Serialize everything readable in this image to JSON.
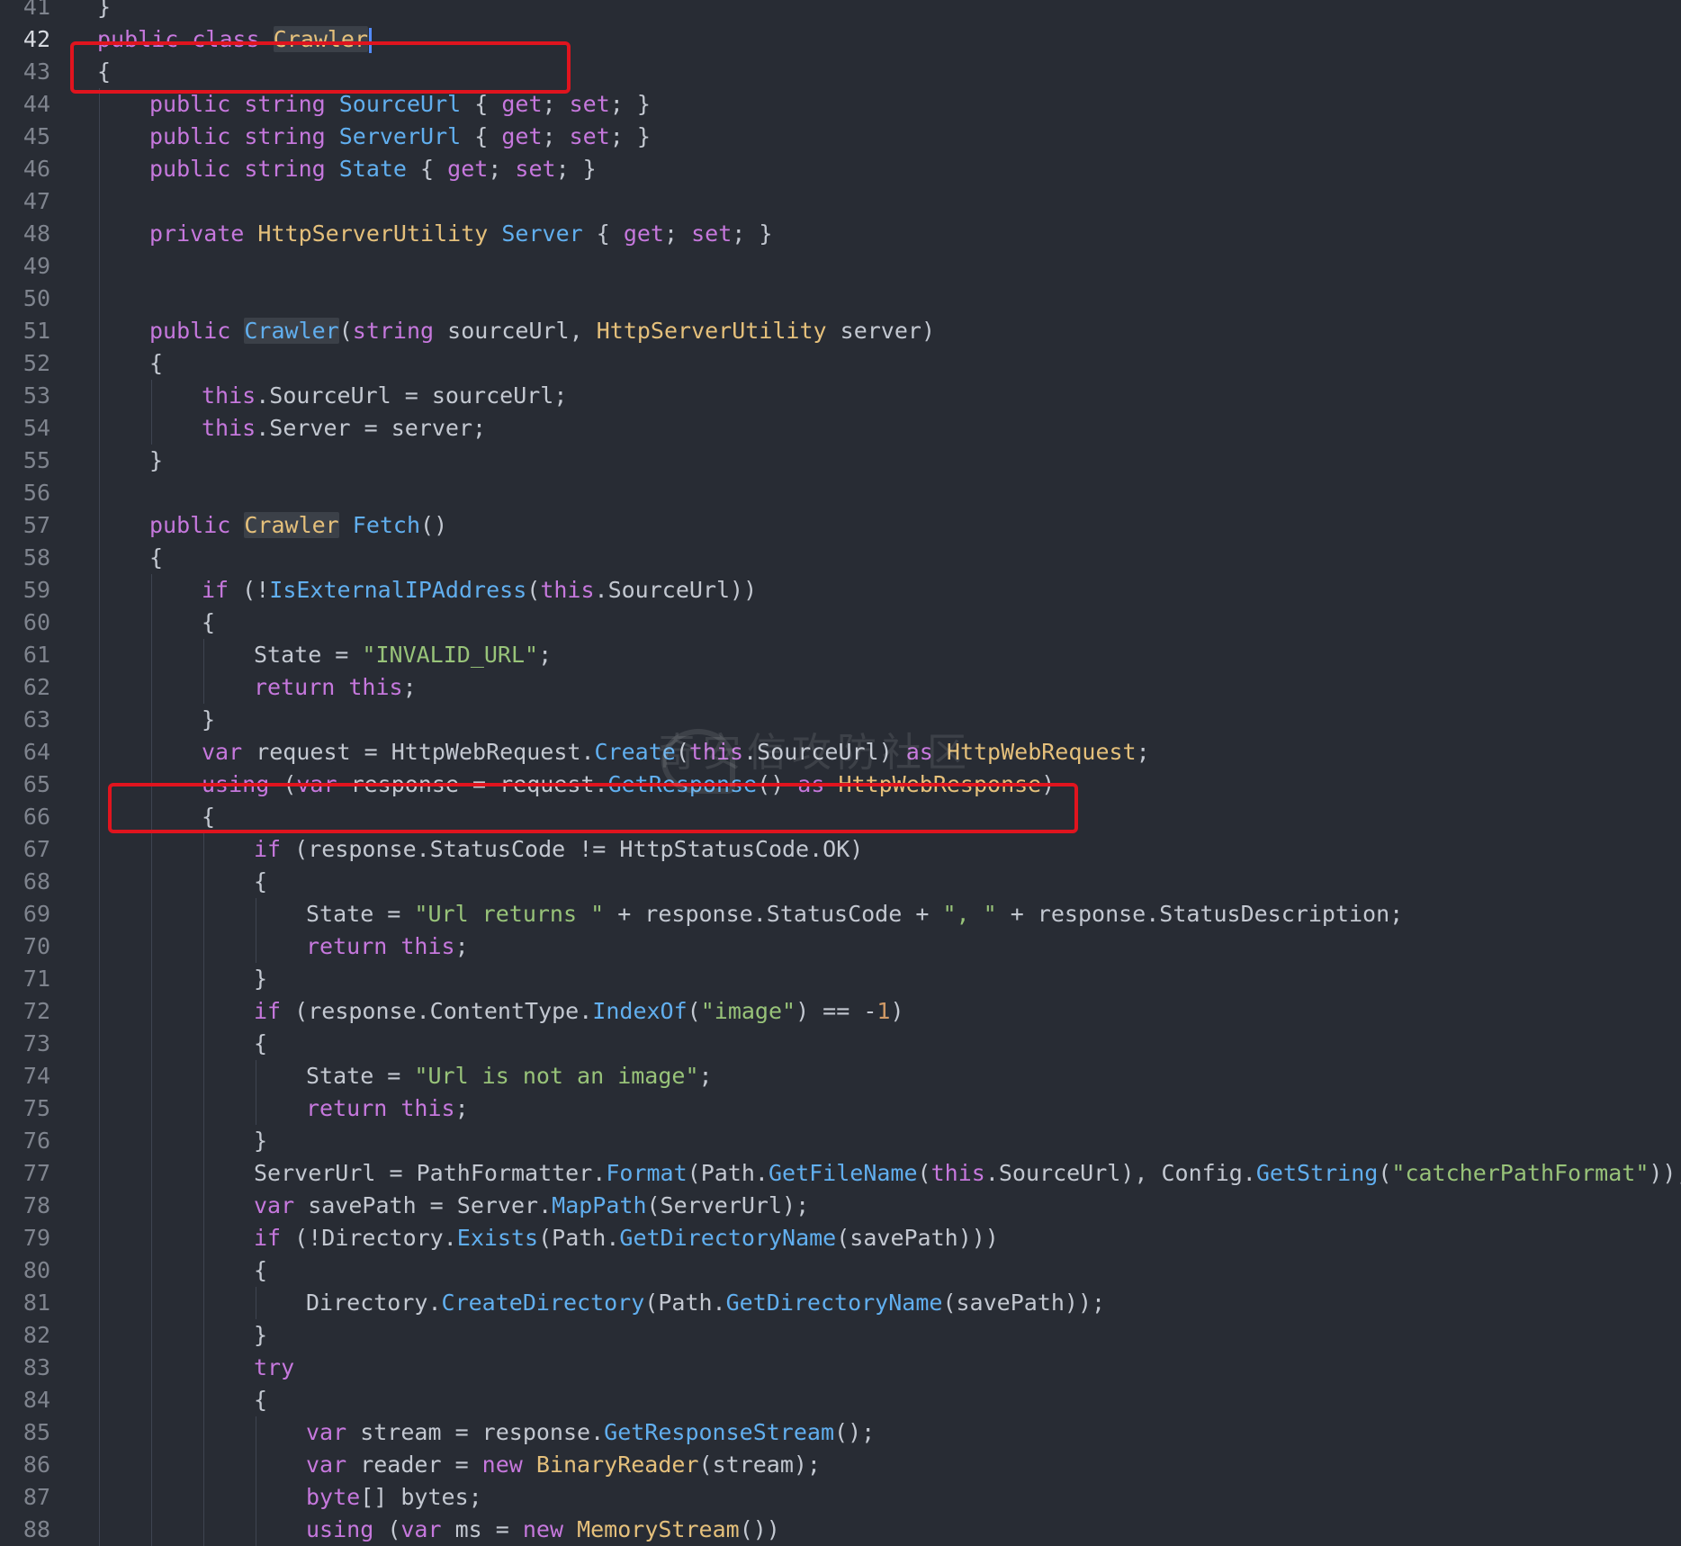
{
  "editor": {
    "lines": [
      {
        "n": "41",
        "indent": 0,
        "tokens": [
          {
            "c": "p",
            "t": "}"
          }
        ]
      },
      {
        "n": "42",
        "indent": 0,
        "active": true,
        "tokens": [
          {
            "c": "k",
            "t": "public class "
          },
          {
            "c": "t hl-word",
            "t": "Crawler"
          }
        ],
        "cursor": true
      },
      {
        "n": "43",
        "indent": 0,
        "tokens": [
          {
            "c": "p",
            "t": "{"
          }
        ]
      },
      {
        "n": "44",
        "indent": 1,
        "tokens": [
          {
            "c": "k",
            "t": "public string "
          },
          {
            "c": "f",
            "t": "SourceUrl"
          },
          {
            "c": "p",
            "t": " { "
          },
          {
            "c": "k",
            "t": "get"
          },
          {
            "c": "p",
            "t": "; "
          },
          {
            "c": "k",
            "t": "set"
          },
          {
            "c": "p",
            "t": "; }"
          }
        ]
      },
      {
        "n": "45",
        "indent": 1,
        "tokens": [
          {
            "c": "k",
            "t": "public string "
          },
          {
            "c": "f",
            "t": "ServerUrl"
          },
          {
            "c": "p",
            "t": " { "
          },
          {
            "c": "k",
            "t": "get"
          },
          {
            "c": "p",
            "t": "; "
          },
          {
            "c": "k",
            "t": "set"
          },
          {
            "c": "p",
            "t": "; }"
          }
        ]
      },
      {
        "n": "46",
        "indent": 1,
        "tokens": [
          {
            "c": "k",
            "t": "public string "
          },
          {
            "c": "f",
            "t": "State"
          },
          {
            "c": "p",
            "t": " { "
          },
          {
            "c": "k",
            "t": "get"
          },
          {
            "c": "p",
            "t": "; "
          },
          {
            "c": "k",
            "t": "set"
          },
          {
            "c": "p",
            "t": "; }"
          }
        ]
      },
      {
        "n": "47",
        "indent": 1,
        "tokens": []
      },
      {
        "n": "48",
        "indent": 1,
        "tokens": [
          {
            "c": "k",
            "t": "private "
          },
          {
            "c": "t",
            "t": "HttpServerUtility"
          },
          {
            "c": "p",
            "t": " "
          },
          {
            "c": "f",
            "t": "Server"
          },
          {
            "c": "p",
            "t": " { "
          },
          {
            "c": "k",
            "t": "get"
          },
          {
            "c": "p",
            "t": "; "
          },
          {
            "c": "k",
            "t": "set"
          },
          {
            "c": "p",
            "t": "; }"
          }
        ]
      },
      {
        "n": "49",
        "indent": 1,
        "tokens": []
      },
      {
        "n": "50",
        "indent": 1,
        "tokens": []
      },
      {
        "n": "51",
        "indent": 1,
        "tokens": [
          {
            "c": "k",
            "t": "public "
          },
          {
            "c": "f hl-word",
            "t": "Crawler"
          },
          {
            "c": "p",
            "t": "("
          },
          {
            "c": "k",
            "t": "string"
          },
          {
            "c": "p",
            "t": " sourceUrl, "
          },
          {
            "c": "t",
            "t": "HttpServerUtility"
          },
          {
            "c": "p",
            "t": " server)"
          }
        ]
      },
      {
        "n": "52",
        "indent": 1,
        "tokens": [
          {
            "c": "p",
            "t": "{"
          }
        ]
      },
      {
        "n": "53",
        "indent": 2,
        "tokens": [
          {
            "c": "k",
            "t": "this"
          },
          {
            "c": "p",
            "t": ".SourceUrl = sourceUrl;"
          }
        ]
      },
      {
        "n": "54",
        "indent": 2,
        "tokens": [
          {
            "c": "k",
            "t": "this"
          },
          {
            "c": "p",
            "t": ".Server = server;"
          }
        ]
      },
      {
        "n": "55",
        "indent": 1,
        "tokens": [
          {
            "c": "p",
            "t": "}"
          }
        ]
      },
      {
        "n": "56",
        "indent": 1,
        "tokens": []
      },
      {
        "n": "57",
        "indent": 1,
        "tokens": [
          {
            "c": "k",
            "t": "public "
          },
          {
            "c": "t hl-word",
            "t": "Crawler"
          },
          {
            "c": "p",
            "t": " "
          },
          {
            "c": "f",
            "t": "Fetch"
          },
          {
            "c": "p",
            "t": "()"
          }
        ]
      },
      {
        "n": "58",
        "indent": 1,
        "tokens": [
          {
            "c": "p",
            "t": "{"
          }
        ]
      },
      {
        "n": "59",
        "indent": 2,
        "tokens": [
          {
            "c": "k",
            "t": "if"
          },
          {
            "c": "p",
            "t": " (!"
          },
          {
            "c": "f",
            "t": "IsExternalIPAddress"
          },
          {
            "c": "p",
            "t": "("
          },
          {
            "c": "k",
            "t": "this"
          },
          {
            "c": "p",
            "t": ".SourceUrl))"
          }
        ]
      },
      {
        "n": "60",
        "indent": 2,
        "tokens": [
          {
            "c": "p",
            "t": "{"
          }
        ]
      },
      {
        "n": "61",
        "indent": 3,
        "tokens": [
          {
            "c": "p",
            "t": "State = "
          },
          {
            "c": "s",
            "t": "\"INVALID_URL\""
          },
          {
            "c": "p",
            "t": ";"
          }
        ]
      },
      {
        "n": "62",
        "indent": 3,
        "tokens": [
          {
            "c": "k",
            "t": "return this"
          },
          {
            "c": "p",
            "t": ";"
          }
        ]
      },
      {
        "n": "63",
        "indent": 2,
        "tokens": [
          {
            "c": "p",
            "t": "}"
          }
        ]
      },
      {
        "n": "64",
        "indent": 2,
        "tokens": [
          {
            "c": "k",
            "t": "var"
          },
          {
            "c": "p",
            "t": " request = HttpWebRequest."
          },
          {
            "c": "f",
            "t": "Create"
          },
          {
            "c": "p",
            "t": "("
          },
          {
            "c": "k",
            "t": "this"
          },
          {
            "c": "p",
            "t": ".SourceUrl) "
          },
          {
            "c": "k",
            "t": "as"
          },
          {
            "c": "p",
            "t": " "
          },
          {
            "c": "t",
            "t": "HttpWebRequest"
          },
          {
            "c": "p",
            "t": ";"
          }
        ]
      },
      {
        "n": "65",
        "indent": 2,
        "tokens": [
          {
            "c": "k",
            "t": "using"
          },
          {
            "c": "p",
            "t": " ("
          },
          {
            "c": "k",
            "t": "var"
          },
          {
            "c": "p",
            "t": " response = request."
          },
          {
            "c": "f",
            "t": "GetResponse"
          },
          {
            "c": "p",
            "t": "() "
          },
          {
            "c": "k",
            "t": "as"
          },
          {
            "c": "p",
            "t": " "
          },
          {
            "c": "t",
            "t": "HttpWebResponse"
          },
          {
            "c": "p",
            "t": ")"
          }
        ]
      },
      {
        "n": "66",
        "indent": 2,
        "tokens": [
          {
            "c": "p",
            "t": "{"
          }
        ]
      },
      {
        "n": "67",
        "indent": 3,
        "tokens": [
          {
            "c": "k",
            "t": "if"
          },
          {
            "c": "p",
            "t": " (response.StatusCode != HttpStatusCode.OK)"
          }
        ]
      },
      {
        "n": "68",
        "indent": 3,
        "tokens": [
          {
            "c": "p",
            "t": "{"
          }
        ]
      },
      {
        "n": "69",
        "indent": 4,
        "tokens": [
          {
            "c": "p",
            "t": "State = "
          },
          {
            "c": "s",
            "t": "\"Url returns \""
          },
          {
            "c": "p",
            "t": " + response.StatusCode + "
          },
          {
            "c": "s",
            "t": "\", \""
          },
          {
            "c": "p",
            "t": " + response.StatusDescription;"
          }
        ]
      },
      {
        "n": "70",
        "indent": 4,
        "tokens": [
          {
            "c": "k",
            "t": "return this"
          },
          {
            "c": "p",
            "t": ";"
          }
        ]
      },
      {
        "n": "71",
        "indent": 3,
        "tokens": [
          {
            "c": "p",
            "t": "}"
          }
        ]
      },
      {
        "n": "72",
        "indent": 3,
        "tokens": [
          {
            "c": "k",
            "t": "if"
          },
          {
            "c": "p",
            "t": " (response.ContentType."
          },
          {
            "c": "f",
            "t": "IndexOf"
          },
          {
            "c": "p",
            "t": "("
          },
          {
            "c": "s",
            "t": "\"image\""
          },
          {
            "c": "p",
            "t": ") == -"
          },
          {
            "c": "n",
            "t": "1"
          },
          {
            "c": "p",
            "t": ")"
          }
        ]
      },
      {
        "n": "73",
        "indent": 3,
        "tokens": [
          {
            "c": "p",
            "t": "{"
          }
        ]
      },
      {
        "n": "74",
        "indent": 4,
        "tokens": [
          {
            "c": "p",
            "t": "State = "
          },
          {
            "c": "s",
            "t": "\"Url is not an image\""
          },
          {
            "c": "p",
            "t": ";"
          }
        ]
      },
      {
        "n": "75",
        "indent": 4,
        "tokens": [
          {
            "c": "k",
            "t": "return this"
          },
          {
            "c": "p",
            "t": ";"
          }
        ]
      },
      {
        "n": "76",
        "indent": 3,
        "tokens": [
          {
            "c": "p",
            "t": "}"
          }
        ]
      },
      {
        "n": "77",
        "indent": 3,
        "tokens": [
          {
            "c": "p",
            "t": "ServerUrl = PathFormatter."
          },
          {
            "c": "f",
            "t": "Format"
          },
          {
            "c": "p",
            "t": "(Path."
          },
          {
            "c": "f",
            "t": "GetFileName"
          },
          {
            "c": "p",
            "t": "("
          },
          {
            "c": "k",
            "t": "this"
          },
          {
            "c": "p",
            "t": ".SourceUrl), Config."
          },
          {
            "c": "f",
            "t": "GetString"
          },
          {
            "c": "p",
            "t": "("
          },
          {
            "c": "s",
            "t": "\"catcherPathFormat\""
          },
          {
            "c": "p",
            "t": "));"
          }
        ]
      },
      {
        "n": "78",
        "indent": 3,
        "tokens": [
          {
            "c": "k",
            "t": "var"
          },
          {
            "c": "p",
            "t": " savePath = Server."
          },
          {
            "c": "f",
            "t": "MapPath"
          },
          {
            "c": "p",
            "t": "(ServerUrl);"
          }
        ]
      },
      {
        "n": "79",
        "indent": 3,
        "tokens": [
          {
            "c": "k",
            "t": "if"
          },
          {
            "c": "p",
            "t": " (!Directory."
          },
          {
            "c": "f",
            "t": "Exists"
          },
          {
            "c": "p",
            "t": "(Path."
          },
          {
            "c": "f",
            "t": "GetDirectoryName"
          },
          {
            "c": "p",
            "t": "(savePath)))"
          }
        ]
      },
      {
        "n": "80",
        "indent": 3,
        "tokens": [
          {
            "c": "p",
            "t": "{"
          }
        ]
      },
      {
        "n": "81",
        "indent": 4,
        "tokens": [
          {
            "c": "p",
            "t": "Directory."
          },
          {
            "c": "f",
            "t": "CreateDirectory"
          },
          {
            "c": "p",
            "t": "(Path."
          },
          {
            "c": "f",
            "t": "GetDirectoryName"
          },
          {
            "c": "p",
            "t": "(savePath));"
          }
        ]
      },
      {
        "n": "82",
        "indent": 3,
        "tokens": [
          {
            "c": "p",
            "t": "}"
          }
        ]
      },
      {
        "n": "83",
        "indent": 3,
        "tokens": [
          {
            "c": "k",
            "t": "try"
          }
        ]
      },
      {
        "n": "84",
        "indent": 3,
        "tokens": [
          {
            "c": "p",
            "t": "{"
          }
        ]
      },
      {
        "n": "85",
        "indent": 4,
        "tokens": [
          {
            "c": "k",
            "t": "var"
          },
          {
            "c": "p",
            "t": " stream = response."
          },
          {
            "c": "f",
            "t": "GetResponseStream"
          },
          {
            "c": "p",
            "t": "();"
          }
        ]
      },
      {
        "n": "86",
        "indent": 4,
        "tokens": [
          {
            "c": "k",
            "t": "var"
          },
          {
            "c": "p",
            "t": " reader = "
          },
          {
            "c": "k",
            "t": "new "
          },
          {
            "c": "t",
            "t": "BinaryReader"
          },
          {
            "c": "p",
            "t": "(stream);"
          }
        ]
      },
      {
        "n": "87",
        "indent": 4,
        "tokens": [
          {
            "c": "k",
            "t": "byte"
          },
          {
            "c": "p",
            "t": "[] bytes;"
          }
        ]
      },
      {
        "n": "88",
        "indent": 4,
        "tokens": [
          {
            "c": "k",
            "t": "using"
          },
          {
            "c": "p",
            "t": " ("
          },
          {
            "c": "k",
            "t": "var"
          },
          {
            "c": "p",
            "t": " ms = "
          },
          {
            "c": "k",
            "t": "new "
          },
          {
            "c": "t",
            "t": "MemoryStream"
          },
          {
            "c": "p",
            "t": "())"
          }
        ]
      }
    ]
  },
  "watermark": {
    "text": "奇安信攻防社区"
  },
  "colors": {
    "background": "#282c34",
    "keyword": "#c678dd",
    "type": "#e5c07b",
    "function": "#61afef",
    "string": "#98c379",
    "highlight_box": "#e0141e"
  }
}
